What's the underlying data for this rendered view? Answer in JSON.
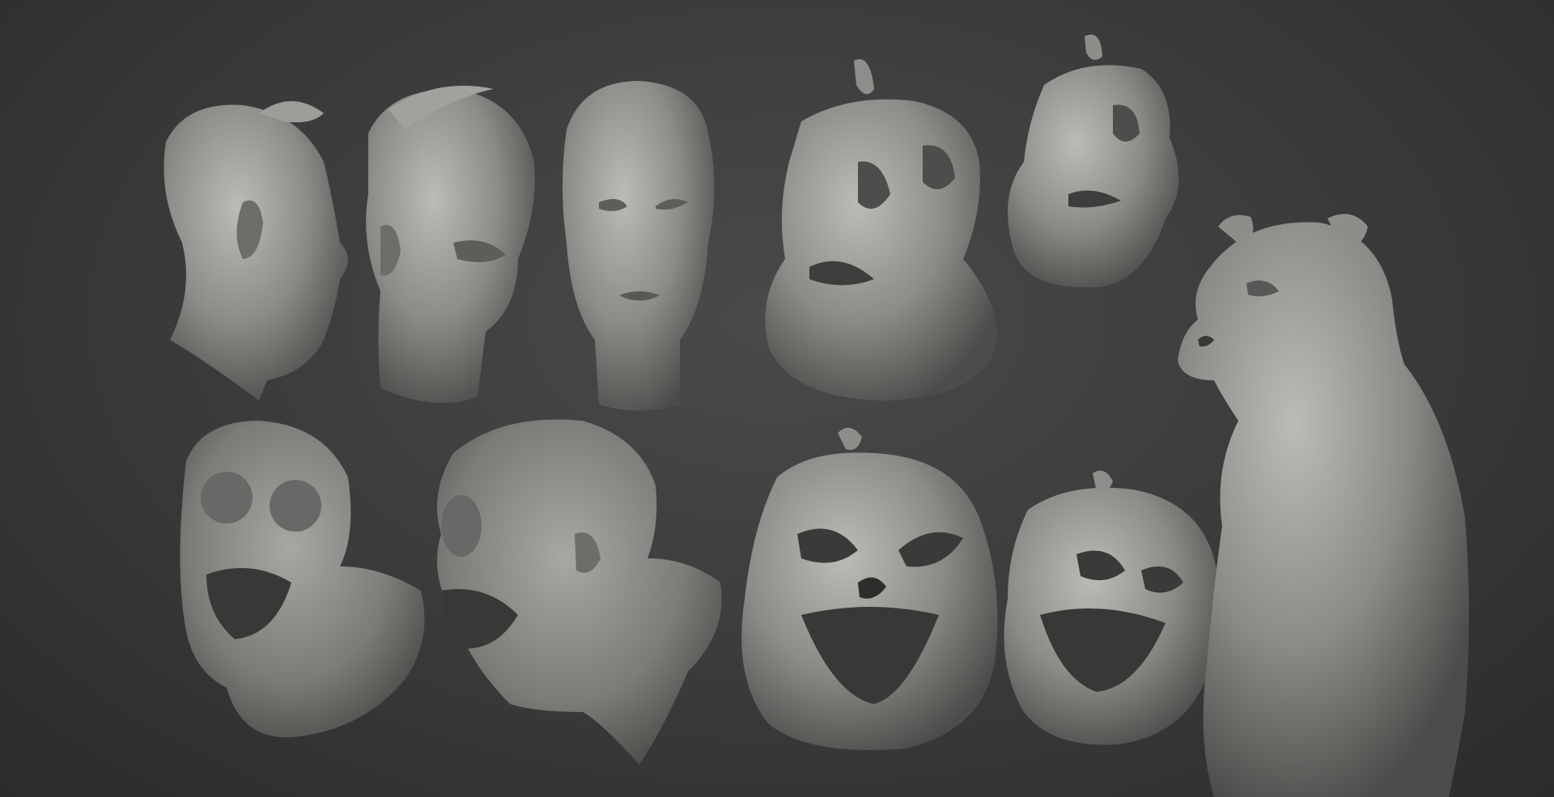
{
  "scene": {
    "background_color": "#3c3c3c",
    "clay_color": "#8a8886",
    "clay_highlight": "#b9b7b4",
    "clay_shadow": "#4a4846"
  },
  "sculpts": [
    {
      "name": "old-man-head-profile",
      "kind": "human-head"
    },
    {
      "name": "old-man-head-three-quarter",
      "kind": "human-head"
    },
    {
      "name": "old-man-head-front",
      "kind": "human-head"
    },
    {
      "name": "pumpkin-gourd-large",
      "kind": "pumpkin"
    },
    {
      "name": "pumpkin-gourd-small",
      "kind": "pumpkin"
    },
    {
      "name": "goggled-zombie-front",
      "kind": "zombie-bust"
    },
    {
      "name": "goggled-zombie-side",
      "kind": "zombie-bust"
    },
    {
      "name": "skull-pumpkin-front",
      "kind": "pumpkin"
    },
    {
      "name": "skull-pumpkin-angled",
      "kind": "pumpkin"
    },
    {
      "name": "bear-bust",
      "kind": "bear"
    }
  ]
}
